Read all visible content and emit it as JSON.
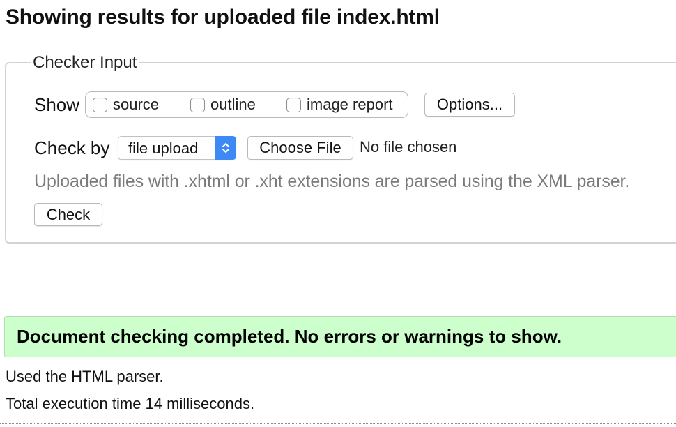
{
  "page": {
    "title": "Showing results for uploaded file index.html"
  },
  "checker": {
    "legend": "Checker Input",
    "show_label": "Show",
    "show_options": [
      {
        "label": "source",
        "checked": false
      },
      {
        "label": "outline",
        "checked": false
      },
      {
        "label": "image report",
        "checked": false
      }
    ],
    "options_button": "Options...",
    "check_by_label": "Check by",
    "check_by_select": {
      "value": "file upload",
      "icon": "up-down-chevrons-icon",
      "accent_color": "#3d8af7"
    },
    "choose_file_button": "Choose File",
    "file_status": "No file chosen",
    "hint": "Uploaded files with .xhtml or .xht extensions are parsed using the XML parser.",
    "check_button": "Check"
  },
  "result": {
    "message": "Document checking completed. No errors or warnings to show.",
    "background_color": "#ccffcc",
    "parser_note": "Used the HTML parser.",
    "execution_time": "Total execution time 14 milliseconds."
  }
}
